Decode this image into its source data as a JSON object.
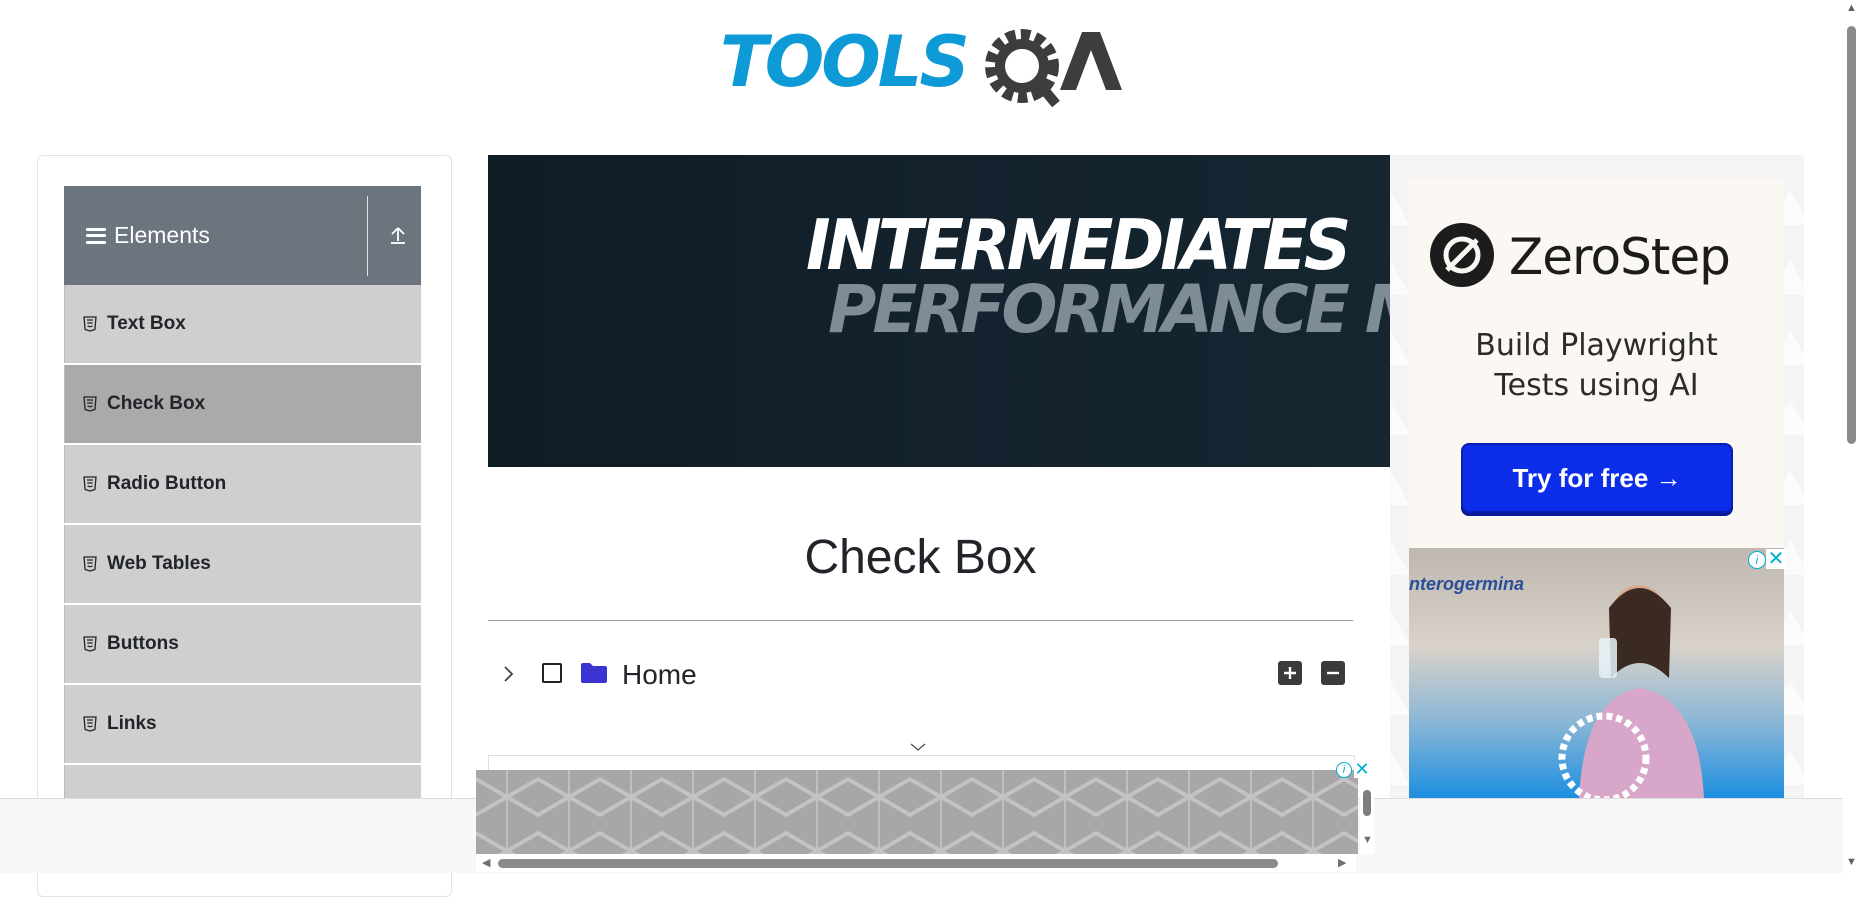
{
  "header": {
    "logo_text": "TOOLSQA"
  },
  "sidebar": {
    "group_title": "Elements",
    "items": [
      {
        "label": "Text Box",
        "active": false
      },
      {
        "label": "Check Box",
        "active": true
      },
      {
        "label": "Radio Button",
        "active": false
      },
      {
        "label": "Web Tables",
        "active": false
      },
      {
        "label": "Buttons",
        "active": false
      },
      {
        "label": "Links",
        "active": false
      },
      {
        "label": "",
        "active": false
      }
    ]
  },
  "banner": {
    "line1": "INTERMEDIATES",
    "line2": "PERFORMANCE MATERIALS"
  },
  "main": {
    "title": "Check Box",
    "tree": {
      "root_label": "Home",
      "checked": false,
      "expanded": false
    }
  },
  "ad_right": {
    "brand": "ZeroStep",
    "tagline_line1": "Build Playwright",
    "tagline_line2": "Tests using AI",
    "cta": "Try for free →",
    "photo_brand": "nterogermina",
    "info_glyph": "i",
    "close_glyph": "✕"
  },
  "bottom_ad": {
    "info_glyph": "i",
    "close_glyph": "✕"
  },
  "colors": {
    "sidebar_header": "#6c757d",
    "menu_item": "#cfcfcf",
    "menu_item_active": "#aaaaaa",
    "logo_blue": "#0d9ad7",
    "logo_dark": "#3d3d3d",
    "cta_blue": "#0d2ee8",
    "folder": "#3c33d3"
  }
}
